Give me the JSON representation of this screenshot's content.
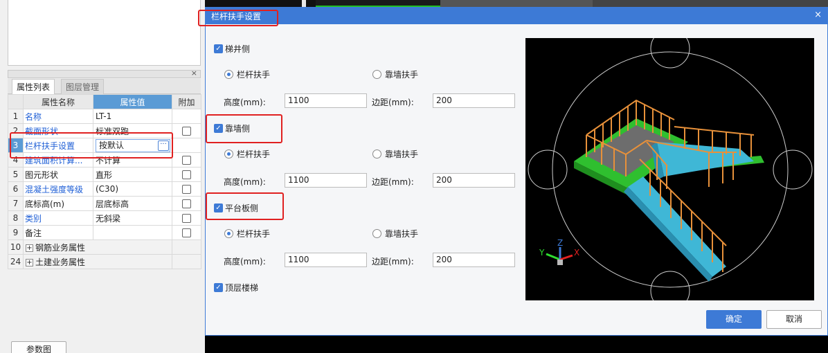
{
  "left_panel": {
    "panel_close": "×",
    "tabs": [
      {
        "label": "属性列表",
        "active": true
      },
      {
        "label": "图层管理",
        "active": false
      }
    ],
    "table": {
      "headers": [
        "属性名称",
        "属性值",
        "附加"
      ],
      "rows": [
        {
          "num": "1",
          "name": "名称",
          "value": "LT-1",
          "blue": true,
          "check": false
        },
        {
          "num": "2",
          "name": "截面形状",
          "value": "标准双跑",
          "blue": true,
          "check": true
        },
        {
          "num": "3",
          "name": "栏杆扶手设置",
          "value": "按默认",
          "blue": true,
          "check": false
        },
        {
          "num": "4",
          "name": "建筑面积计算...",
          "value": "不计算",
          "blue": true,
          "check": true
        },
        {
          "num": "5",
          "name": "图元形状",
          "value": "直形",
          "blue": false,
          "check": true
        },
        {
          "num": "6",
          "name": "混凝土强度等级",
          "value": "(C30)",
          "blue": true,
          "check": true
        },
        {
          "num": "7",
          "name": "底标高(m)",
          "value": "层底标高",
          "blue": false,
          "check": true
        },
        {
          "num": "8",
          "name": "类别",
          "value": "无斜梁",
          "blue": true,
          "check": true
        },
        {
          "num": "9",
          "name": "备注",
          "value": "",
          "blue": false,
          "check": true
        },
        {
          "num": "10",
          "name": "钢筋业务属性",
          "value": "",
          "blue": false,
          "check": false
        },
        {
          "num": "24",
          "name": "土建业务属性",
          "value": "",
          "blue": false,
          "check": false
        }
      ],
      "edit_button": "···",
      "expand": "+"
    },
    "param_button": "参数图"
  },
  "dialog": {
    "title": "栏杆扶手设置",
    "close": "×",
    "check_mark": "✓",
    "sections": [
      {
        "label": "梯井侧",
        "checked": true,
        "radio1": "栏杆扶手",
        "radio2": "靠墙扶手",
        "selected": 1,
        "height_label": "高度(mm):",
        "height": "1100",
        "margin_label": "边距(mm):",
        "margin": "200"
      },
      {
        "label": "靠墙侧",
        "checked": true,
        "radio1": "栏杆扶手",
        "radio2": "靠墙扶手",
        "selected": 1,
        "height_label": "高度(mm):",
        "height": "1100",
        "margin_label": "边距(mm):",
        "margin": "200"
      },
      {
        "label": "平台板侧",
        "checked": true,
        "radio1": "栏杆扶手",
        "radio2": "靠墙扶手",
        "selected": 1,
        "height_label": "高度(mm):",
        "height": "1100",
        "margin_label": "边距(mm):",
        "margin": "200"
      }
    ],
    "top_floor": {
      "label": "顶层楼梯",
      "checked": true
    },
    "ok": "确定",
    "cancel": "取消",
    "axes": {
      "x": "X",
      "y": "Y",
      "z": "Z"
    }
  },
  "colors": {
    "accent": "#3d7ad6",
    "highlight_red": "#e02020",
    "railing_orange": "#e8913a",
    "stair_cyan": "#3fb7d6",
    "slab_green": "#2fbf2f"
  }
}
